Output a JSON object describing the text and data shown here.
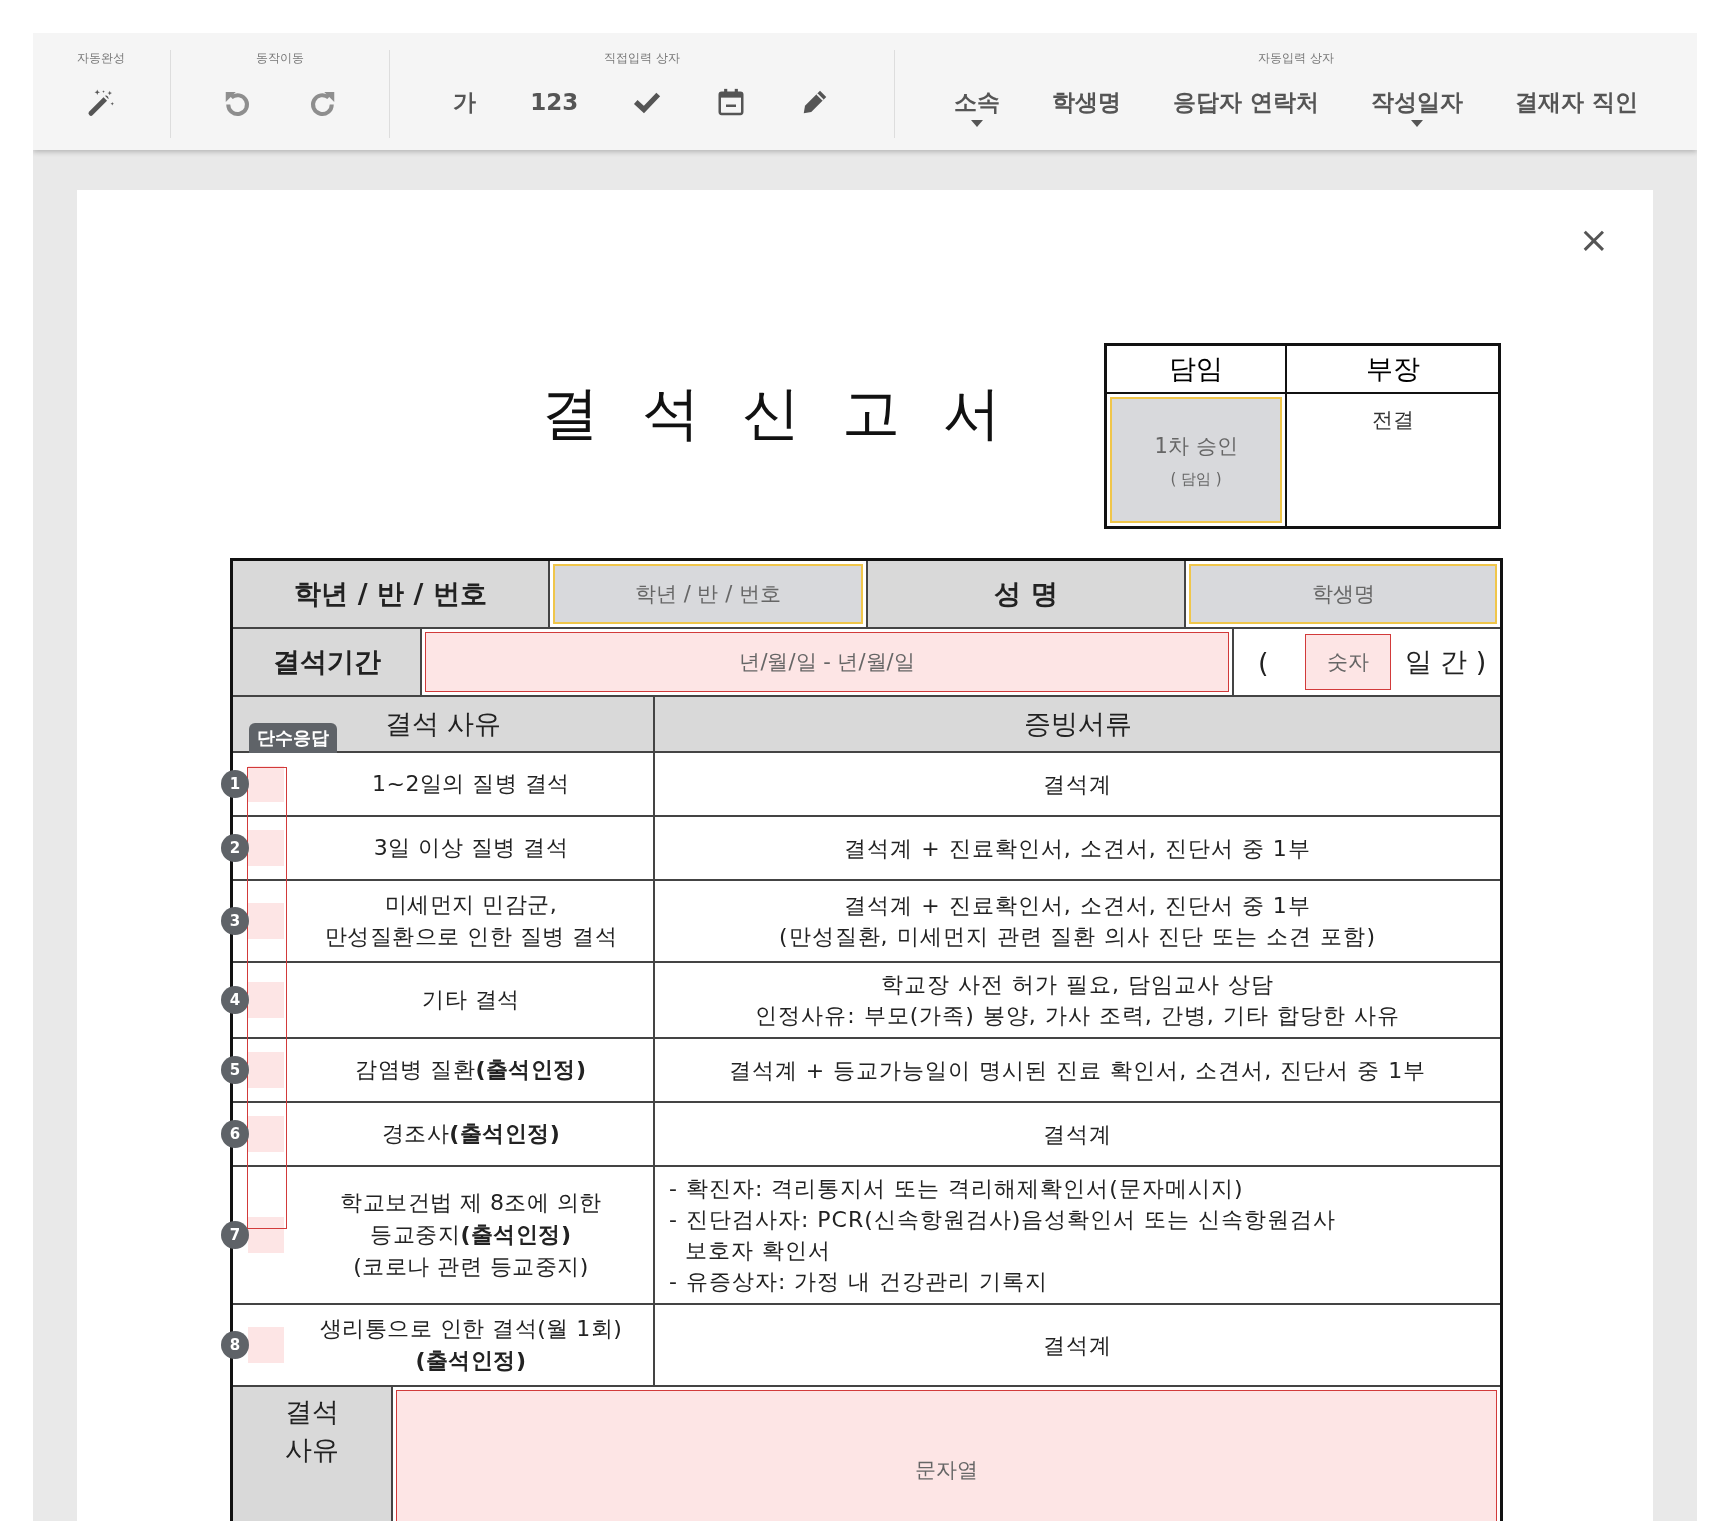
{
  "toolbar": {
    "groups": [
      {
        "label": "자동완성",
        "tools": [
          {
            "kind": "wand",
            "disabled": false,
            "has_menu": false
          }
        ]
      },
      {
        "label": "동작이동",
        "tools": [
          {
            "kind": "undo",
            "disabled": true,
            "has_menu": false
          },
          {
            "kind": "redo",
            "disabled": true,
            "has_menu": false
          }
        ]
      },
      {
        "label": "직접입력 상자",
        "tools": [
          {
            "kind": "text",
            "label": "가",
            "disabled": false,
            "has_menu": false
          },
          {
            "kind": "text",
            "label": "123",
            "disabled": false,
            "has_menu": false
          },
          {
            "kind": "check",
            "disabled": false,
            "has_menu": false
          },
          {
            "kind": "calendar",
            "disabled": false,
            "has_menu": false
          },
          {
            "kind": "pencil",
            "disabled": false,
            "has_menu": false
          }
        ]
      },
      {
        "label": "자동입력 상자",
        "tools": [
          {
            "kind": "text",
            "label": "소속",
            "disabled": false,
            "has_menu": true
          },
          {
            "kind": "text",
            "label": "학생명",
            "disabled": false,
            "has_menu": false
          },
          {
            "kind": "text",
            "label": "응답자 연락처",
            "disabled": false,
            "has_menu": false
          },
          {
            "kind": "text",
            "label": "작성일자",
            "disabled": false,
            "has_menu": true
          },
          {
            "kind": "text",
            "label": "결재자 직인",
            "disabled": false,
            "has_menu": false
          }
        ]
      }
    ]
  },
  "close_button": "×",
  "document": {
    "title": "결 석 신 고 서",
    "approval": {
      "headers": [
        "담임",
        "부장"
      ],
      "signer": {
        "kind": "auto",
        "label": "1차 승인",
        "sub": "( 담임 )"
      },
      "note": "전결"
    },
    "student_row": [
      {
        "kind": "label",
        "text": "학년 / 반 / 번호"
      },
      {
        "kind": "auto",
        "placeholder": "학년 / 반 / 번호"
      },
      {
        "kind": "label",
        "text": "성 명"
      },
      {
        "kind": "auto",
        "placeholder": "학생명"
      }
    ],
    "period_row": {
      "label": "결석기간",
      "dates": {
        "kind": "direct",
        "placeholder": "년/월/일 - 년/월/일"
      },
      "open": "(",
      "days": {
        "kind": "direct",
        "placeholder": "숫자"
      },
      "close": "일 간 )"
    },
    "reasons": {
      "headers": [
        "결석 사유",
        "증빙서류"
      ],
      "answer_type": "단수응답",
      "rows": [
        {
          "number": "1",
          "reason": "1~2일의 질병 결석",
          "evidence": "결석계",
          "kind": "center",
          "selected": false
        },
        {
          "number": "2",
          "reason": "3일 이상 질병 결석",
          "evidence": "결석계 + 진료확인서, 소견서, 진단서 중 1부",
          "kind": "center",
          "selected": false
        },
        {
          "number": "3",
          "reason": "미세먼지 민감군,\n만성질환으로 인한 질병 결석",
          "evidence": "결석계 + 진료확인서, 소견서, 진단서 중 1부\n(만성질환, 미세먼지 관련 질환 의사 진단 또는 소견 포함)",
          "kind": "center",
          "selected": false
        },
        {
          "number": "4",
          "reason": "기타 결석",
          "evidence": "학교장 사전 허가 필요, 담임교사 상담\n인정사유: 부모(가족) 봉양, 가사 조력, 간병, 기타 합당한 사유",
          "kind": "center",
          "selected": false
        },
        {
          "number": "5",
          "reason": "감염병 질환**(출석인정)**",
          "evidence": "결석계 + 등교가능일이 명시된 진료 확인서, 소견서, 진단서 중 1부",
          "kind": "center",
          "selected": false
        },
        {
          "number": "6",
          "reason": "경조사**(출석인정)**",
          "evidence": "결석계",
          "kind": "center",
          "selected": false
        },
        {
          "number": "7",
          "reason": "학교보건법 제 8조에 의한\n등교중지**(출석인정)**\n(코로나 관련 등교중지)",
          "evidence": "- 확진자: 격리통지서 또는 격리해제확인서(문자메시지)\n- 진단검사자: PCR(신속항원검사)음성확인서 또는 신속항원검사\n  보호자 확인서\n- 유증상자: 가정 내 건강관리 기록지",
          "kind": "left",
          "selected": false
        },
        {
          "number": "8",
          "reason": "생리통으로 인한 결석(월 1회)\n**(출석인정)**",
          "evidence": "결석계",
          "kind": "center",
          "selected": false
        }
      ]
    },
    "detail_row": {
      "label": "결석\n사유",
      "field": {
        "kind": "direct",
        "placeholder": "문자열"
      }
    }
  }
}
